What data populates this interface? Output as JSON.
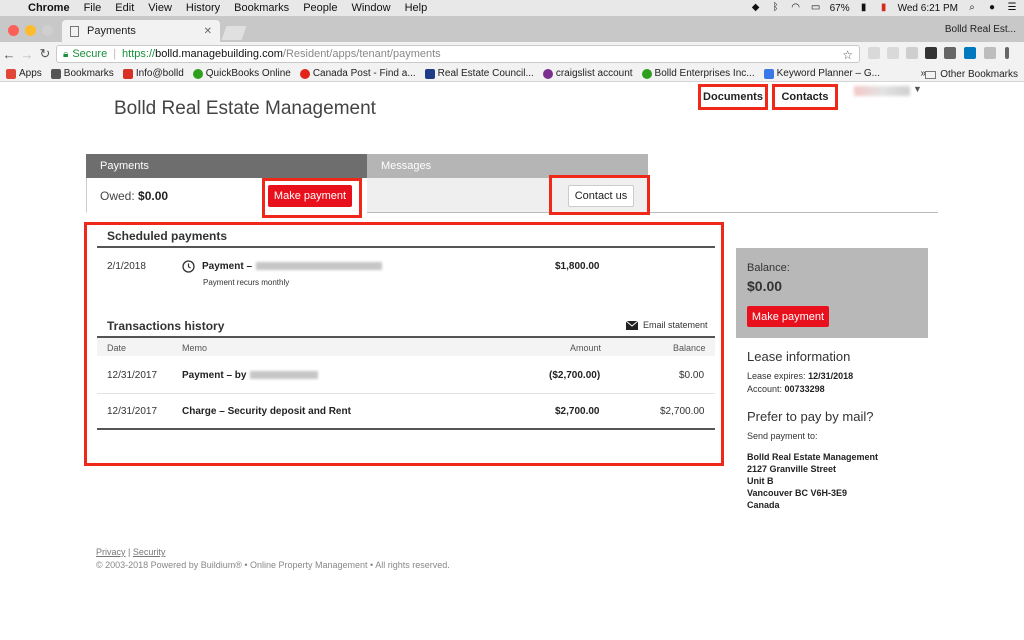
{
  "menubar": {
    "app": "Chrome",
    "items": [
      "File",
      "Edit",
      "View",
      "History",
      "Bookmarks",
      "People",
      "Window",
      "Help"
    ],
    "battery": "67%",
    "clock": "Wed 6:21 PM"
  },
  "browser": {
    "tab_title": "Payments",
    "window_label": "Bolld Real Est...",
    "secure_label": "Secure",
    "url_scheme": "https://",
    "url_host": "bolld.managebuilding.com",
    "url_path": "/Resident/apps/tenant/payments",
    "bookmarks": [
      {
        "label": "Apps",
        "color": "#e0473a"
      },
      {
        "label": "Bookmarks",
        "color": "#555555"
      },
      {
        "label": "Info@bolld",
        "color": "#d93025"
      },
      {
        "label": "QuickBooks Online",
        "color": "#2ca01c"
      },
      {
        "label": "Canada Post - Find a...",
        "color": "#e1251b"
      },
      {
        "label": "Real Estate Council...",
        "color": "#1f3c88"
      },
      {
        "label": "craigslist account",
        "color": "#7b2f8e"
      },
      {
        "label": "Bolld Enterprises Inc...",
        "color": "#2ca01c"
      },
      {
        "label": "Keyword Planner – G...",
        "color": "#3b78e7"
      }
    ],
    "bookmarks_overflow": "»",
    "other_bookmarks": "Other Bookmarks"
  },
  "header": {
    "brand": "Bolld Real Estate Management",
    "nav": {
      "documents": "Documents",
      "contacts": "Contacts"
    }
  },
  "tabs": {
    "payments": "Payments",
    "messages": "Messages",
    "owed_label": "Owed:",
    "owed_value": "$0.00",
    "make_payment": "Make payment",
    "contact_us": "Contact us"
  },
  "scheduled": {
    "title": "Scheduled payments",
    "date": "2/1/2018",
    "label": "Payment –",
    "sub": "Payment recurs monthly",
    "amount": "$1,800.00"
  },
  "history": {
    "title": "Transactions history",
    "email_statement": "Email statement",
    "columns": {
      "date": "Date",
      "memo": "Memo",
      "amount": "Amount",
      "balance": "Balance"
    },
    "rows": [
      {
        "date": "12/31/2017",
        "memo": "Payment – by",
        "amount": "($2,700.00)",
        "balance": "$0.00"
      },
      {
        "date": "12/31/2017",
        "memo": "Charge – Security deposit and Rent",
        "amount": "$2,700.00",
        "balance": "$2,700.00"
      }
    ]
  },
  "sidebar": {
    "balance_label": "Balance:",
    "balance_value": "$0.00",
    "make_payment": "Make payment",
    "lease_title": "Lease information",
    "lease_expires_label": "Lease expires:",
    "lease_expires": "12/31/2018",
    "account_label": "Account:",
    "account": "00733298",
    "mail_title": "Prefer to pay by mail?",
    "send_to": "Send payment to:",
    "address": [
      "Bolld Real Estate Management",
      "2127 Granville Street",
      "Unit B",
      "Vancouver BC V6H-3E9",
      "Canada"
    ]
  },
  "footer": {
    "privacy": "Privacy",
    "divider": "|",
    "security": "Security",
    "copyright": "© 2003-2018 Powered by Buildium® • Online Property Management • All rights reserved."
  },
  "colors": {
    "accent_red": "#e8101d",
    "highlight": "#f0281a",
    "secure_green": "#1a8f3b"
  }
}
